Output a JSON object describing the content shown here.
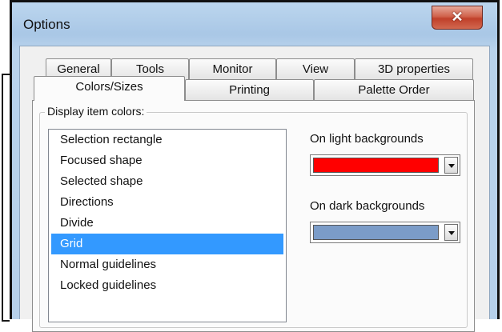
{
  "window": {
    "title": "Options",
    "close_glyph": "✕"
  },
  "tabs_row1": [
    "General",
    "Tools",
    "Monitor",
    "View",
    "3D properties"
  ],
  "tabs_row2": [
    "Colors/Sizes",
    "Printing",
    "Palette Order"
  ],
  "active_tab": "Colors/Sizes",
  "group_label": "Display item colors:",
  "display_items": [
    "Selection rectangle",
    "Focused shape",
    "Selected shape",
    "Directions",
    "Divide",
    "Grid",
    "Normal guidelines",
    "Locked guidelines"
  ],
  "selected_item": "Grid",
  "light": {
    "label": "On light backgrounds",
    "color": "#ff0000"
  },
  "dark": {
    "label": "On dark backgrounds",
    "color": "#7b9cc8"
  },
  "colors": {
    "selection_highlight": "#3399ff",
    "close_button": "#c0402a"
  }
}
